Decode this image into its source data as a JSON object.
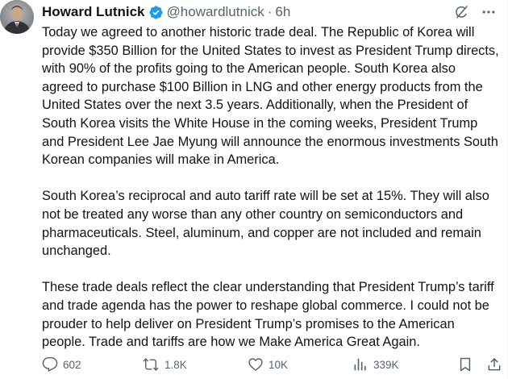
{
  "author": {
    "name": "Howard Lutnick",
    "handle": "@howardlutnick",
    "separator": "·",
    "time": "6h",
    "verified": true,
    "avatar_icon": "avatar-photo"
  },
  "header_icons": {
    "grok": "grok-icon",
    "more": "more-icon"
  },
  "body": {
    "paragraphs": [
      "Today we agreed to another historic trade deal. The Republic of Korea will provide $350 Billion for the United States to invest as President Trump directs, with 90% of the profits going to the American people. South Korea also agreed to purchase $100 Billion in LNG and other energy products from the United States over the next 3.5 years. Additionally, when the President of South Korea visits the White House in the coming weeks, President Trump and President Lee Jae Myung will announce the enormous investments South Korean companies will make in America.",
      "South Korea’s reciprocal and auto tariff rate will be set at 15%. They will also not be treated any worse than any other country on semiconductors and pharmaceuticals. Steel, aluminum, and copper are not included and remain unchanged.",
      "These trade deals reflect the clear understanding that President Trump’s tariff and trade agenda has the power to reshape global commerce. I could not be prouder to help deliver on President Trump’s promises to the American people. Trade and tariffs are how we Make America Great Again."
    ]
  },
  "actions": {
    "replies": "602",
    "reposts": "1.8K",
    "likes": "10K",
    "views": "339K"
  },
  "colors": {
    "text": "#0f1419",
    "muted": "#536471",
    "verified_blue": "#1d9bf0",
    "icon": "#536471"
  }
}
